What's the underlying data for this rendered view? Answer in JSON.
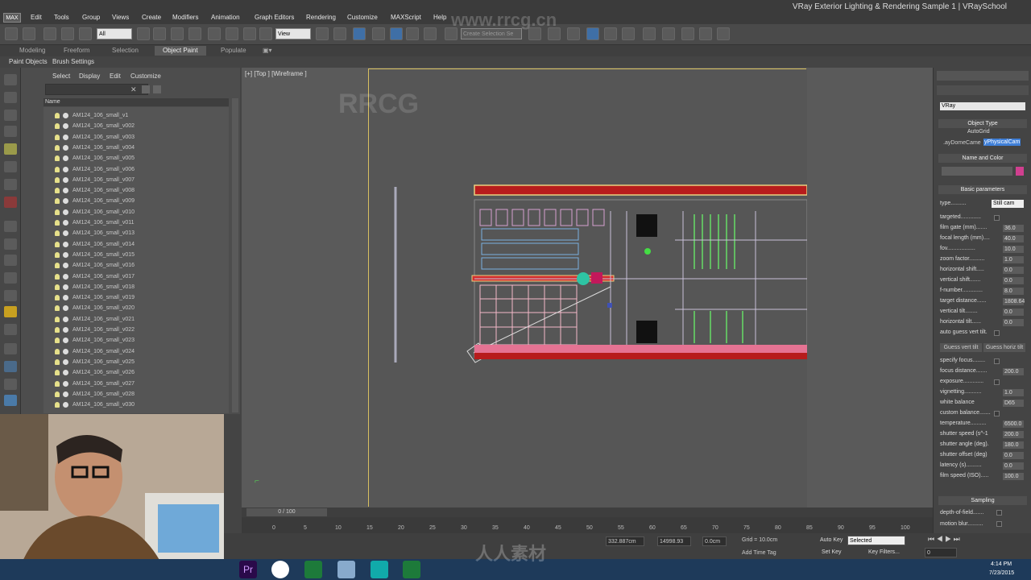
{
  "window": {
    "title": "VRay Exterior Lighting & Rendering Sample 1 | VRaySchool",
    "logo": "MAX"
  },
  "menu": [
    "Edit",
    "Tools",
    "Group",
    "Views",
    "Create",
    "Modifiers",
    "Animation",
    "Graph Editors",
    "Rendering",
    "Customize",
    "MAXScript",
    "Help"
  ],
  "toolbar": {
    "selection_filter": "All",
    "ref_coord": "View",
    "named_sel": "Create Selection Se"
  },
  "ribbon": {
    "tabs": [
      "Modeling",
      "Freeform",
      "Selection",
      "Object Paint",
      "Populate"
    ],
    "active": "Object Paint",
    "sub": [
      "Paint Objects",
      "Brush Settings"
    ]
  },
  "explorer": {
    "menu": [
      "Select",
      "Display",
      "Edit",
      "Customize"
    ],
    "column": "Name",
    "items": [
      "AM124_106_small_v1",
      "AM124_106_small_v002",
      "AM124_106_small_v003",
      "AM124_106_small_v004",
      "AM124_106_small_v005",
      "AM124_106_small_v006",
      "AM124_106_small_v007",
      "AM124_106_small_v008",
      "AM124_106_small_v009",
      "AM124_106_small_v010",
      "AM124_106_small_v011",
      "AM124_106_small_v013",
      "AM124_106_small_v014",
      "AM124_106_small_v015",
      "AM124_106_small_v016",
      "AM124_106_small_v017",
      "AM124_106_small_v018",
      "AM124_106_small_v019",
      "AM124_106_small_v020",
      "AM124_106_small_v021",
      "AM124_106_small_v022",
      "AM124_106_small_v023",
      "AM124_106_small_v024",
      "AM124_106_small_v025",
      "AM124_106_small_v026",
      "AM124_106_small_v027",
      "AM124_106_small_v028",
      "AM124_106_small_v030"
    ]
  },
  "viewport": {
    "label": "[+] [Top ] [Wireframe ]"
  },
  "timeline": {
    "frame": "0 / 100",
    "ticks": [
      "0",
      "5",
      "10",
      "15",
      "20",
      "25",
      "30",
      "35",
      "40",
      "45",
      "50",
      "55",
      "60",
      "65",
      "70",
      "75",
      "80",
      "85",
      "90",
      "95",
      "100"
    ]
  },
  "status": {
    "x": "332.887cm",
    "y": "14998.93",
    "z": "0.0cm",
    "grid": "Grid = 10.0cm",
    "add_time_tag": "Add Time Tag",
    "auto_key": "Auto Key",
    "set_key": "Set Key",
    "key_mode": "Selected",
    "key_filters": "Key Filters...",
    "frame": "0"
  },
  "taskbar": {
    "time": "4:14 PM",
    "date": "7/23/2015"
  },
  "cmd": {
    "renderer": "VRay",
    "object_type": "Object Type",
    "autogrid": "AutoGrid",
    "btn1": ".ayDomeCame",
    "btn2": "yPhysicalCam",
    "name_color": "Name and Color",
    "basic": "Basic parameters",
    "type_label": "type..........",
    "type_value": "Still cam",
    "params": [
      {
        "label": "targeted.............",
        "value": ""
      },
      {
        "label": "film gate (mm).......",
        "value": "36.0"
      },
      {
        "label": "focal length (mm)....",
        "value": "40.0"
      },
      {
        "label": "fov..................",
        "value": "10.0"
      },
      {
        "label": "zoom factor..........",
        "value": "1.0"
      },
      {
        "label": "horizontal shift.....",
        "value": "0.0"
      },
      {
        "label": "vertical shift.......",
        "value": "0.0"
      },
      {
        "label": "f-number.............",
        "value": "8.0"
      },
      {
        "label": "target distance......",
        "value": "1808.64"
      },
      {
        "label": "vertical tilt........",
        "value": "0.0"
      },
      {
        "label": "horizontal tilt......",
        "value": "0.0"
      },
      {
        "label": "auto guess vert tilt.",
        "value": ""
      }
    ],
    "guess_vert": "Guess vert tilt",
    "guess_horiz": "Guess horiz tilt",
    "params2": [
      {
        "label": "specify focus........",
        "value": ""
      },
      {
        "label": "focus distance.......",
        "value": "200.0"
      },
      {
        "label": "exposure.............",
        "value": ""
      },
      {
        "label": "vignetting...........",
        "value": "1.0"
      },
      {
        "label": "white balance",
        "value": "D65"
      },
      {
        "label": "custom balance.......",
        "value": ""
      },
      {
        "label": "temperature..........",
        "value": "6500.0"
      },
      {
        "label": "shutter speed (s^-1",
        "value": "200.0"
      },
      {
        "label": "shutter angle (deg).",
        "value": "180.0"
      },
      {
        "label": "shutter offset (deg)",
        "value": "0.0"
      },
      {
        "label": "latency (s)..........",
        "value": "0.0"
      },
      {
        "label": "film speed (ISO).....",
        "value": "100.0"
      }
    ],
    "sampling": "Sampling",
    "dof": "depth-of-field.......",
    "mblur": "motion blur.........."
  },
  "watermarks": [
    "RRCG",
    "人人素材",
    "www.rrcg.cn"
  ]
}
